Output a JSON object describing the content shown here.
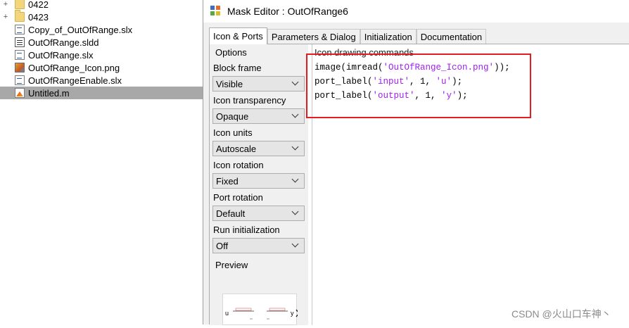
{
  "file_browser": {
    "items": [
      {
        "name": "0422",
        "type": "folder",
        "toggle": "+"
      },
      {
        "name": "0423",
        "type": "folder",
        "toggle": "+"
      },
      {
        "name": "Copy_of_OutOfRange.slx",
        "type": "model"
      },
      {
        "name": "OutOfRange.sldd",
        "type": "dictionary"
      },
      {
        "name": "OutOfRange.slx",
        "type": "model"
      },
      {
        "name": "OutOfRange_Icon.png",
        "type": "image"
      },
      {
        "name": "OutOfRangeEnable.slx",
        "type": "model"
      },
      {
        "name": "Untitled.m",
        "type": "script",
        "selected": true
      }
    ]
  },
  "mask_editor": {
    "title": "Mask Editor : OutOfRange6",
    "tabs": [
      {
        "label": "Icon & Ports",
        "active": true
      },
      {
        "label": "Parameters & Dialog"
      },
      {
        "label": "Initialization"
      },
      {
        "label": "Documentation"
      }
    ],
    "options": {
      "header": "Options",
      "fields": [
        {
          "label": "Block frame",
          "value": "Visible"
        },
        {
          "label": "Icon transparency",
          "value": "Opaque"
        },
        {
          "label": "Icon units",
          "value": "Autoscale"
        },
        {
          "label": "Icon rotation",
          "value": "Fixed"
        },
        {
          "label": "Port rotation",
          "value": "Default"
        },
        {
          "label": "Run initialization",
          "value": "Off"
        }
      ],
      "preview_label": "Preview",
      "preview": {
        "left_port": "u",
        "right_port": "y"
      }
    },
    "icon_drawing": {
      "header": "Icon drawing commands",
      "lines": [
        {
          "pre": "image(imread(",
          "str": "'OutOfRange_Icon.png'",
          "post": "));"
        },
        {
          "pre": "port_label(",
          "str": "'input'",
          "mid": ", 1, ",
          "str2": "'u'",
          "post": ");"
        },
        {
          "pre": "port_label(",
          "str": "'output'",
          "mid": ", 1, ",
          "str2": "'y'",
          "post": ");"
        }
      ]
    }
  },
  "watermark": "CSDN @火山口车神丶",
  "colors": {
    "highlight": "#e02020",
    "string": "#a020f0",
    "selection": "#a8a8a8"
  }
}
